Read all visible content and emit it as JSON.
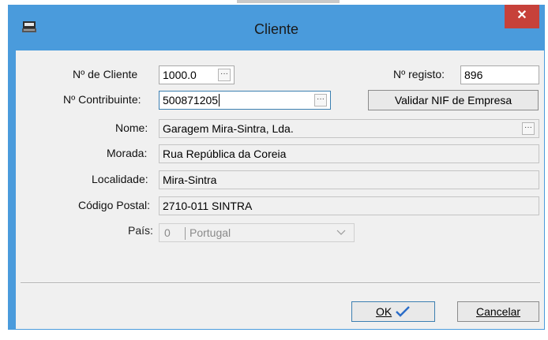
{
  "window": {
    "title": "Cliente",
    "close": "✕"
  },
  "labels": {
    "n_cliente": "Nº de Cliente",
    "n_registo": "Nº registo:",
    "n_contribuinte": "Nº Contribuinte:",
    "nome": "Nome:",
    "morada": "Morada:",
    "localidade": "Localidade:",
    "codigo_postal": "Código Postal:",
    "pais": "País:"
  },
  "values": {
    "n_cliente": "1000.0",
    "n_registo": "896",
    "n_contribuinte": "500871205",
    "nome": "Garagem Mira-Sintra, Lda.",
    "morada": "Rua República da Coreia",
    "localidade": "Mira-Sintra",
    "codigo_postal": "2710-011 SINTRA",
    "pais_code": "0",
    "pais_name": "Portugal"
  },
  "buttons": {
    "validar": "Validar NIF de Empresa",
    "ok": "OK",
    "cancelar": "Cancelar",
    "ellipsis": "···"
  },
  "colors": {
    "frame": "#4a9bdc",
    "close": "#c7413a",
    "ok_check": "#2a6cc8"
  }
}
